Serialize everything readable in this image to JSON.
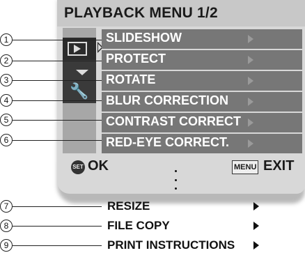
{
  "menu": {
    "title": "PLAYBACK MENU 1/2",
    "items": [
      {
        "num": "1",
        "label": "SLIDESHOW"
      },
      {
        "num": "2",
        "label": "PROTECT"
      },
      {
        "num": "3",
        "label": "ROTATE"
      },
      {
        "num": "4",
        "label": "BLUR CORRECTION"
      },
      {
        "num": "5",
        "label": "CONTRAST CORRECT"
      },
      {
        "num": "6",
        "label": "RED-EYE CORRECT."
      }
    ],
    "footer": {
      "set_icon": "SET",
      "ok_label": "OK",
      "menu_icon": "MENU",
      "exit_label": "EXIT"
    }
  },
  "extra_items": [
    {
      "num": "7",
      "label": "RESIZE"
    },
    {
      "num": "8",
      "label": "FILE COPY"
    },
    {
      "num": "9",
      "label": "PRINT INSTRUCTIONS"
    }
  ],
  "icons": [
    "playback-tab-icon",
    "down-arrow-icon",
    "wrench-icon",
    "right-arrow-icon",
    "set-button-icon",
    "menu-button-icon"
  ]
}
